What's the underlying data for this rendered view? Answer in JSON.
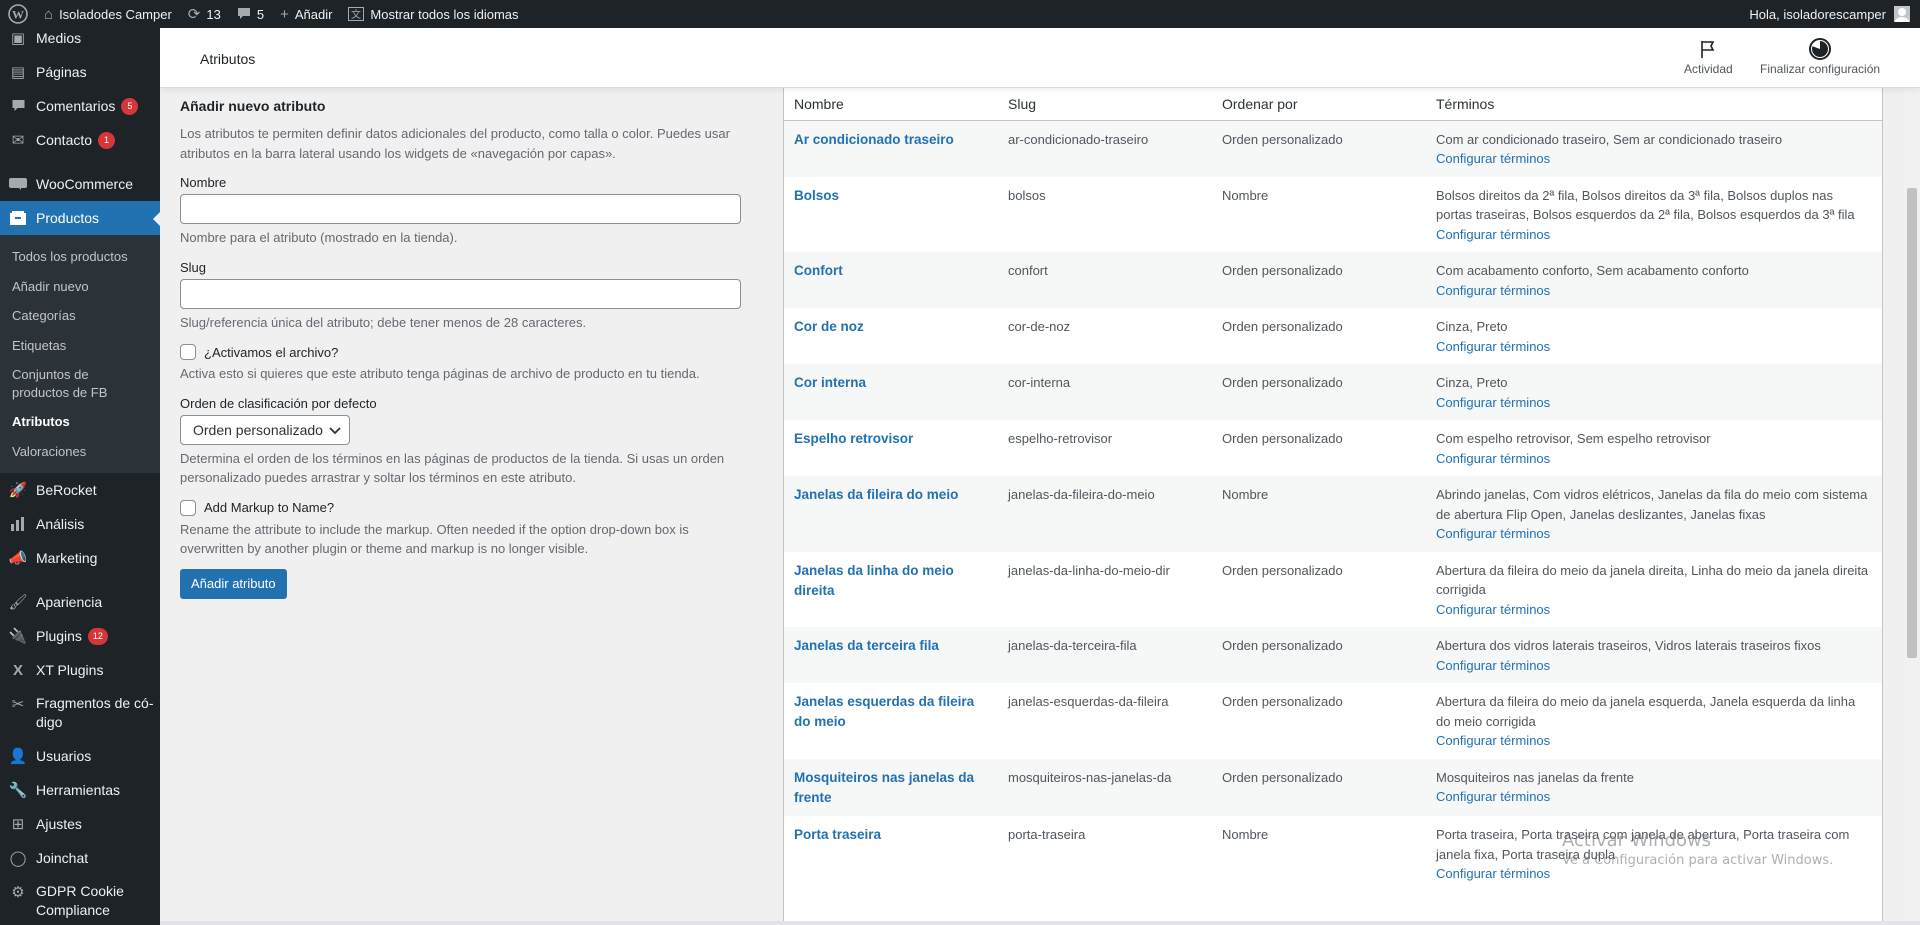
{
  "adminbar": {
    "site_name": "Isoladodes Camper",
    "updates_count": "13",
    "comments_count": "5",
    "new_label": "Añadir",
    "languages_label": "Mostrar todos los idiomas",
    "greeting": "Hola, isoladorescamper"
  },
  "sidebar": {
    "items": [
      {
        "label": "Medios",
        "icon": "media-icon"
      },
      {
        "label": "Páginas",
        "icon": "pages-icon"
      },
      {
        "label": "Comentarios",
        "icon": "comments-icon",
        "badge": "5"
      },
      {
        "label": "Contacto",
        "icon": "mail-icon",
        "badge": "1"
      },
      {
        "label": "WooCommerce",
        "icon": "woocommerce-icon"
      },
      {
        "label": "Productos",
        "icon": "products-icon"
      },
      {
        "label": "BeRocket",
        "icon": "rocket-icon"
      },
      {
        "label": "Análisis",
        "icon": "analytics-icon"
      },
      {
        "label": "Marketing",
        "icon": "megaphone-icon"
      },
      {
        "label": "Apariencia",
        "icon": "brush-icon"
      },
      {
        "label": "Plugins",
        "icon": "plugin-icon",
        "badge": "12"
      },
      {
        "label": "XT Plugins",
        "icon": "xt-icon"
      },
      {
        "label": "Fragmentos de có-digo",
        "icon": "scissors-icon"
      },
      {
        "label": "Usuarios",
        "icon": "users-icon"
      },
      {
        "label": "Herramientas",
        "icon": "wrench-icon"
      },
      {
        "label": "Ajustes",
        "icon": "settings-icon"
      },
      {
        "label": "Joinchat",
        "icon": "whatsapp-icon"
      },
      {
        "label": "GDPR Cookie Compliance",
        "icon": "gdpr-icon"
      }
    ],
    "submenu": [
      "Todos los productos",
      "Añadir nuevo",
      "Categorías",
      "Etiquetas",
      "Conjuntos de productos de FB",
      "Atributos",
      "Valoraciones"
    ]
  },
  "header": {
    "title": "Atributos",
    "activity_label": "Actividad",
    "finish_label": "Finalizar configuración"
  },
  "form": {
    "heading": "Añadir nuevo atributo",
    "intro": "Los atributos te permiten definir datos adicionales del producto, como talla o color. Puedes usar atributos en la barra lateral usando los widgets de «navegación por capas».",
    "name_label": "Nombre",
    "name_hint": "Nombre para el atributo (mostrado en la tienda).",
    "slug_label": "Slug",
    "slug_hint": "Slug/referencia única del atributo; debe tener menos de 28 caracteres.",
    "archive_label": "¿Activamos el archivo?",
    "archive_hint": "Activa esto si quieres que este atributo tenga páginas de archivo de producto en tu tienda.",
    "order_label": "Orden de clasificación por defecto",
    "order_value": "Orden personalizado",
    "order_hint": "Determina el orden de los términos en las páginas de productos de la tienda. Si usas un orden personalizado puedes arrastrar y soltar los términos en este atributo.",
    "markup_label": "Add Markup to Name?",
    "markup_hint": "Rename the attribute to include the markup. Often needed if the option drop-down box is overwritten by another plugin or theme and markup is no longer visible.",
    "submit_label": "Añadir atributo"
  },
  "table": {
    "headers": [
      "Nombre",
      "Slug",
      "Ordenar por",
      "Términos"
    ],
    "configure_label": "Configurar términos",
    "rows": [
      {
        "name": "Ar condicionado traseiro",
        "slug": "ar-condicionado-traseiro",
        "order": "Orden personalizado",
        "terms": "Com ar condicionado traseiro, Sem ar condicionado traseiro"
      },
      {
        "name": "Bolsos",
        "slug": "bolsos",
        "order": "Nombre",
        "terms": "Bolsos direitos da 2ª fila, Bolsos direitos da 3ª fila, Bolsos duplos nas portas traseiras, Bolsos esquerdos da 2ª fila, Bolsos esquerdos da 3ª fila"
      },
      {
        "name": "Confort",
        "slug": "confort",
        "order": "Orden personalizado",
        "terms": "Com acabamento conforto, Sem acabamento conforto"
      },
      {
        "name": "Cor de noz",
        "slug": "cor-de-noz",
        "order": "Orden personalizado",
        "terms": "Cinza, Preto"
      },
      {
        "name": "Cor interna",
        "slug": "cor-interna",
        "order": "Orden personalizado",
        "terms": "Cinza, Preto"
      },
      {
        "name": "Espelho retrovisor",
        "slug": "espelho-retrovisor",
        "order": "Orden personalizado",
        "terms": "Com espelho retrovisor, Sem espelho retrovisor"
      },
      {
        "name": "Janelas da fileira do meio",
        "slug": "janelas-da-fileira-do-meio",
        "order": "Nombre",
        "terms": "Abrindo janelas, Com vidros elétricos, Janelas da fila do meio com sistema de abertura Flip Open, Janelas deslizantes, Janelas fixas"
      },
      {
        "name": "Janelas da linha do meio direita",
        "slug": "janelas-da-linha-do-meio-dir",
        "order": "Orden personalizado",
        "terms": "Abertura da fileira do meio da janela direita, Linha do meio da janela direita corrigida"
      },
      {
        "name": "Janelas da terceira fila",
        "slug": "janelas-da-terceira-fila",
        "order": "Orden personalizado",
        "terms": "Abertura dos vidros laterais traseiros, Vidros laterais traseiros fixos"
      },
      {
        "name": "Janelas esquerdas da fileira do meio",
        "slug": "janelas-esquerdas-da-fileira",
        "order": "Orden personalizado",
        "terms": "Abertura da fileira do meio da janela esquerda, Janela esquerda da linha do meio corrigida"
      },
      {
        "name": "Mosquiteiros nas janelas da frente",
        "slug": "mosquiteiros-nas-janelas-da",
        "order": "Orden personalizado",
        "terms": "Mosquiteiros nas janelas da frente"
      },
      {
        "name": "Porta traseira",
        "slug": "porta-traseira",
        "order": "Nombre",
        "terms": "Porta traseira, Porta traseira com janela de abertura, Porta traseira com janela fixa, Porta traseira dupla"
      }
    ]
  },
  "watermark": {
    "line1": "Activar Windows",
    "line2": "Ve a Configuración para activar Windows."
  }
}
